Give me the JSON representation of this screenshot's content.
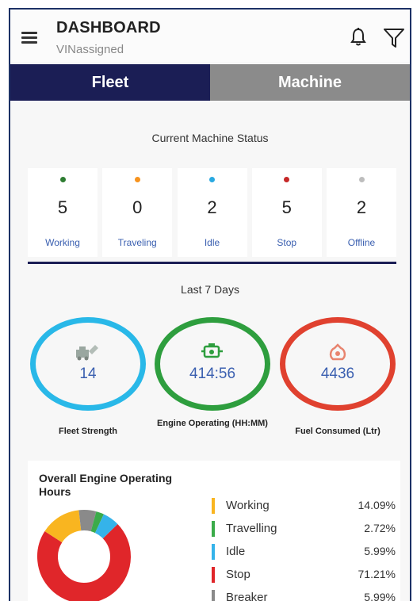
{
  "header": {
    "title": "DASHBOARD",
    "subtitle": "VINassigned"
  },
  "tabs": [
    {
      "label": "Fleet",
      "active": true
    },
    {
      "label": "Machine",
      "active": false
    }
  ],
  "machine_status": {
    "heading": "Current Machine Status",
    "items": [
      {
        "label": "Working",
        "count": "5",
        "color": "#2e7d32"
      },
      {
        "label": "Traveling",
        "count": "0",
        "color": "#f7931e"
      },
      {
        "label": "Idle",
        "count": "2",
        "color": "#29a9e1"
      },
      {
        "label": "Stop",
        "count": "5",
        "color": "#c62828"
      },
      {
        "label": "Offline",
        "count": "2",
        "color": "#bdbdbd"
      }
    ]
  },
  "summary": {
    "heading": "Last 7 Days",
    "gauges": [
      {
        "value": "14",
        "caption": "Fleet Strength",
        "color": "#29b8e8",
        "icon": "fleet-icon"
      },
      {
        "value": "414:56",
        "caption": "Engine Operating (HH:MM)",
        "color": "#2e9e3e",
        "icon": "engine-icon"
      },
      {
        "value": "4436",
        "caption": "Fuel Consumed (Ltr)",
        "color": "#e0412f",
        "icon": "fuel-icon"
      }
    ]
  },
  "operating_hours": {
    "title": "Overall Engine Operating Hours",
    "legend": [
      {
        "label": "Working",
        "value": "14.09%",
        "color": "#f9b520"
      },
      {
        "label": "Travelling",
        "value": "2.72%",
        "color": "#3bab4a"
      },
      {
        "label": "Idle",
        "value": "5.99%",
        "color": "#35b3ea"
      },
      {
        "label": "Stop",
        "value": "71.21%",
        "color": "#e0262a"
      },
      {
        "label": "Breaker",
        "value": "5.99%",
        "color": "#8a8a8a"
      }
    ]
  },
  "chart_data": {
    "type": "pie",
    "title": "Overall Engine Operating Hours",
    "categories": [
      "Stop",
      "Working",
      "Breaker",
      "Travelling",
      "Idle"
    ],
    "values": [
      71.21,
      14.09,
      5.99,
      2.72,
      5.99
    ],
    "colors": [
      "#e0262a",
      "#f9b520",
      "#8a8a8a",
      "#3bab4a",
      "#35b3ea"
    ],
    "units": "%"
  }
}
